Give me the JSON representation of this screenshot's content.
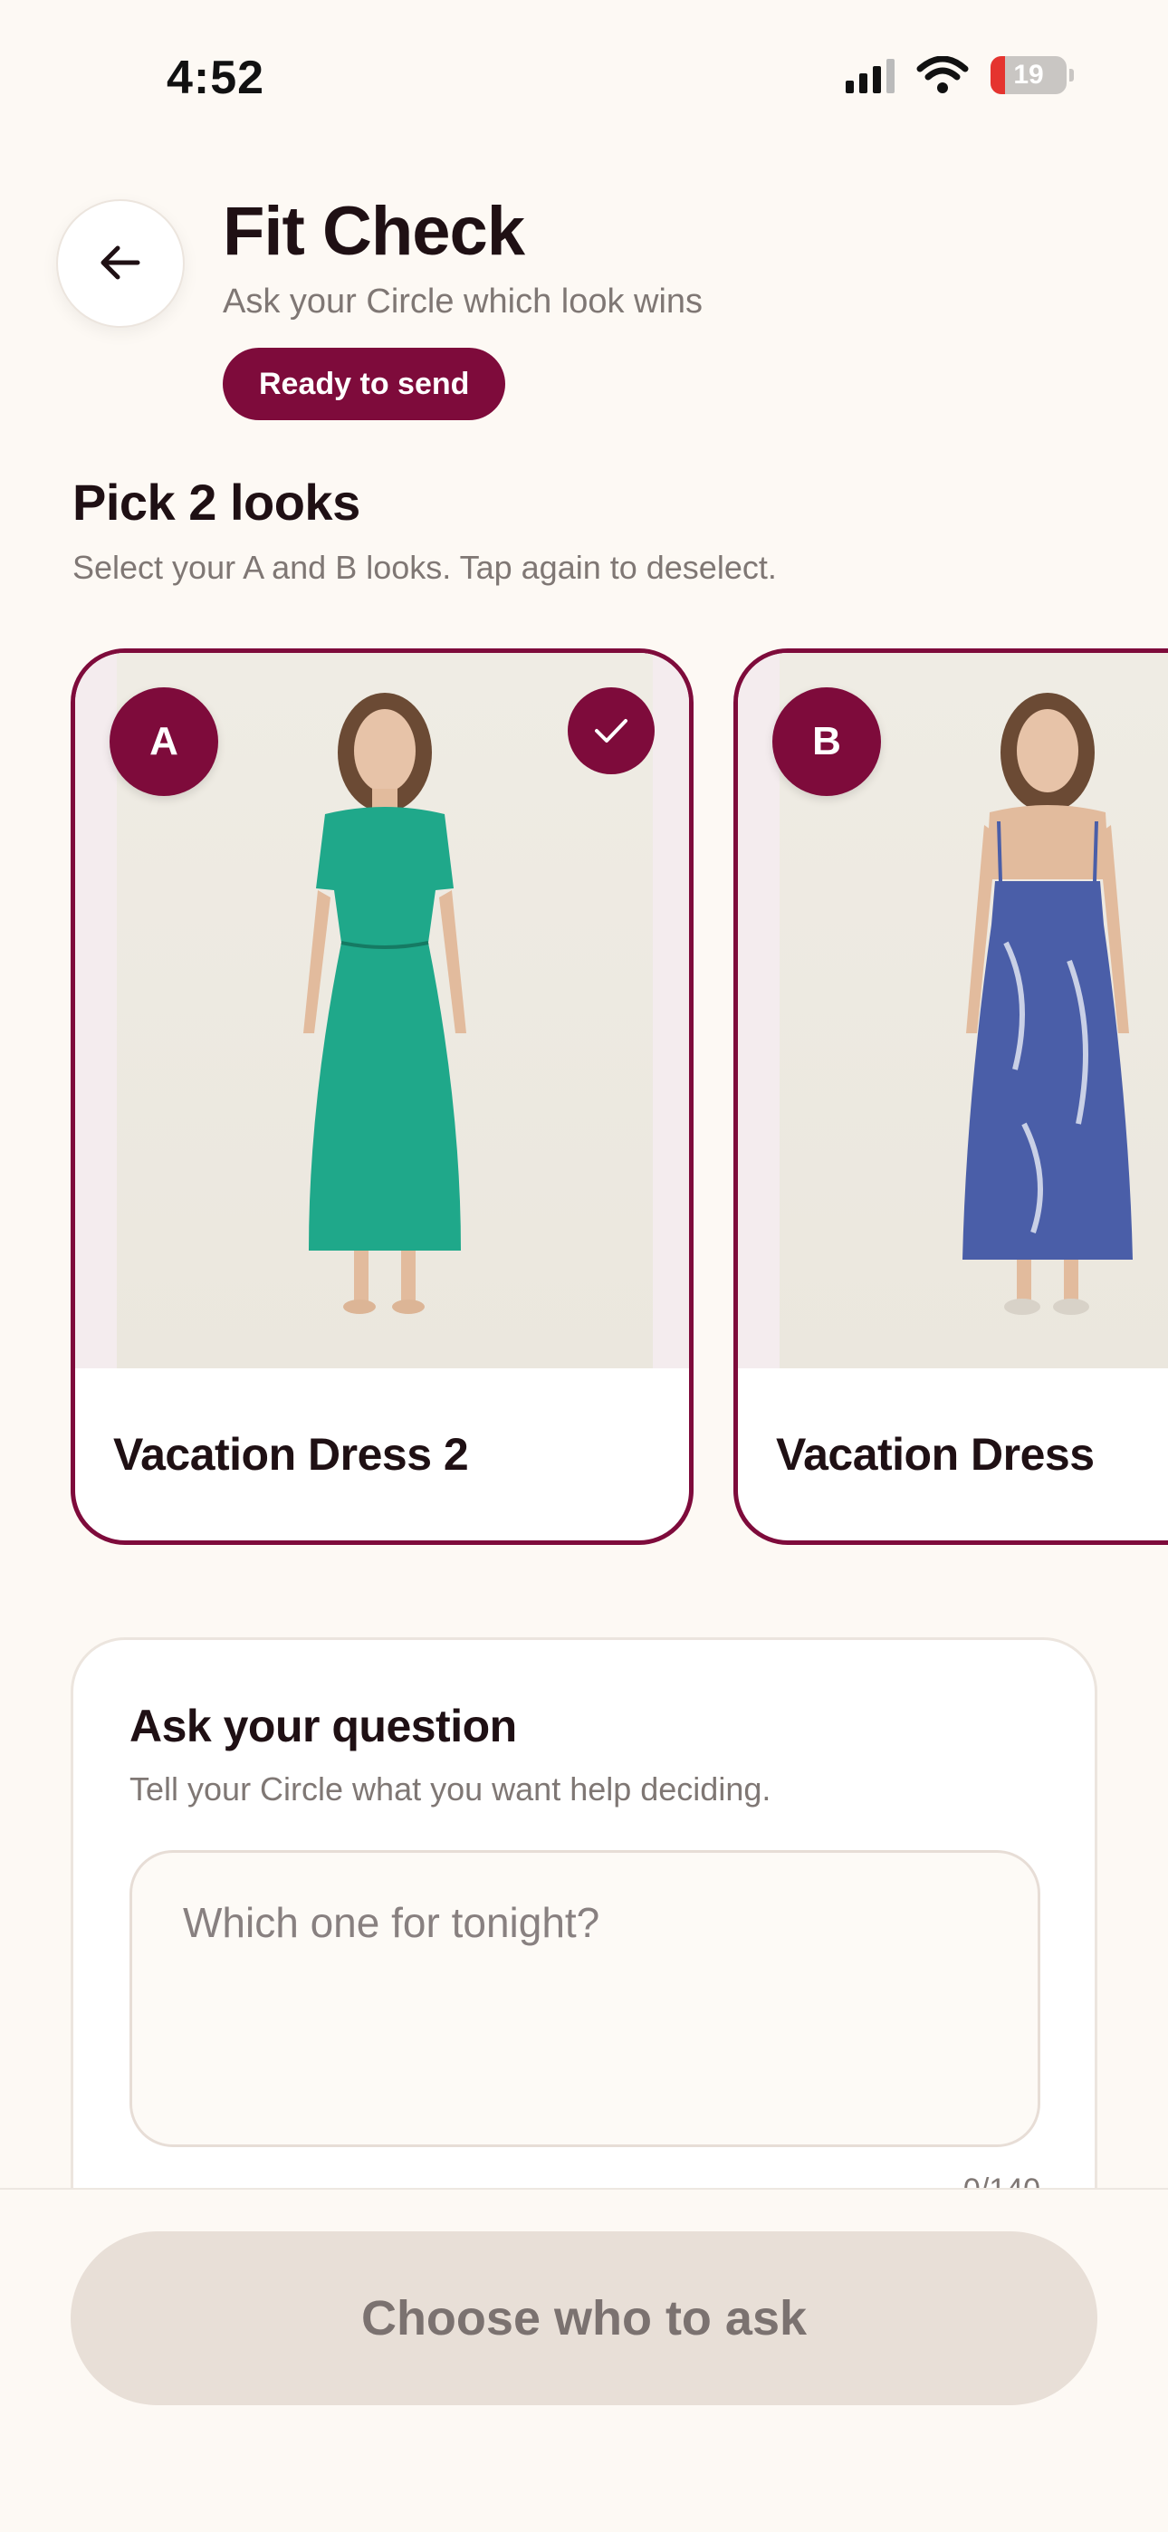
{
  "status_bar": {
    "time": "4:52",
    "battery_level": "19",
    "battery_color": "#e5342f"
  },
  "header": {
    "back_icon": "arrow-left-icon",
    "title": "Fit Check",
    "subtitle": "Ask your Circle which look wins",
    "badge": "Ready to send"
  },
  "picker": {
    "title": "Pick 2 looks",
    "hint": "Select your A and B looks. Tap again to deselect.",
    "looks": [
      {
        "letter": "A",
        "label": "Vacation Dress 2",
        "selected": true,
        "dress_color": "#1fa88a"
      },
      {
        "letter": "B",
        "label": "Vacation Dress",
        "selected": false,
        "dress_color": "#4a5ea8"
      }
    ]
  },
  "question": {
    "title": "Ask your question",
    "hint": "Tell your Circle what you want help deciding.",
    "placeholder": "Which one for tonight?",
    "value": "",
    "count": "0/140"
  },
  "cta": {
    "label": "Choose who to ask"
  },
  "colors": {
    "accent": "#7e0b3b",
    "background": "#fdf9f4",
    "disabled_button": "#e8dfd7"
  }
}
